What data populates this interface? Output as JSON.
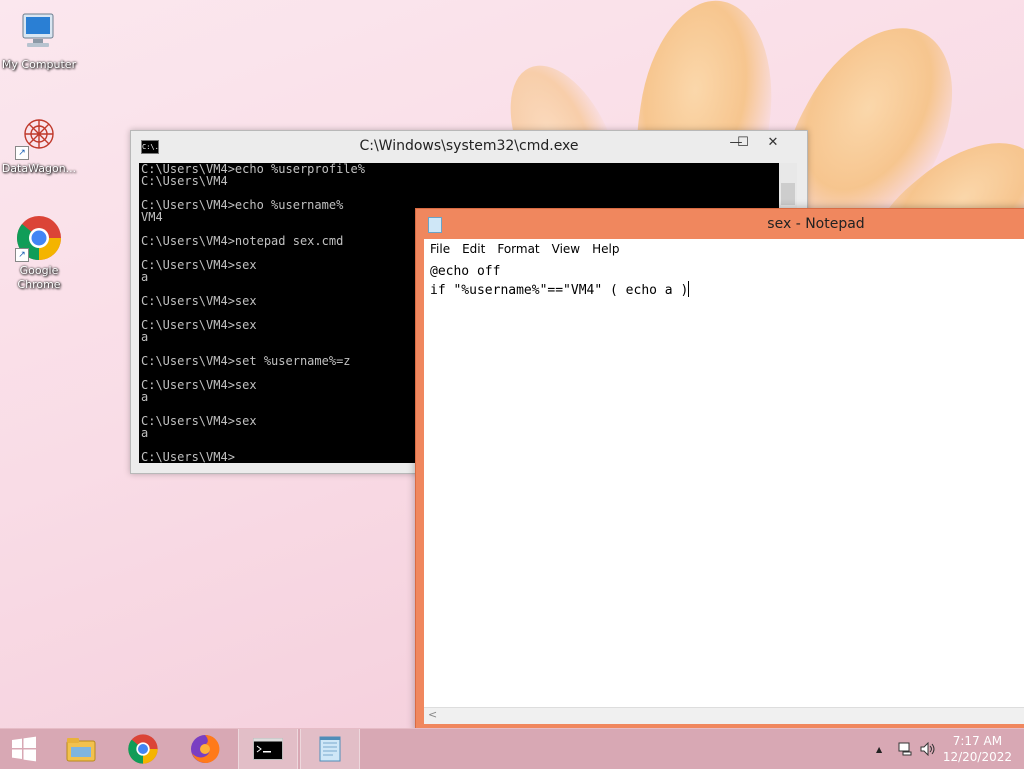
{
  "desktop": {
    "icons": [
      {
        "label": "My Computer",
        "icon": "computer-icon"
      },
      {
        "label": "DataWagon...",
        "icon": "datawagon-icon"
      },
      {
        "label": "Google Chrome",
        "icon": "chrome-icon"
      }
    ]
  },
  "cmd": {
    "title": "C:\\Windows\\system32\\cmd.exe",
    "icon_text": "C:\\.",
    "lines": [
      "C:\\Users\\VM4>echo %userprofile%",
      "C:\\Users\\VM4",
      "",
      "C:\\Users\\VM4>echo %username%",
      "VM4",
      "",
      "C:\\Users\\VM4>notepad sex.cmd",
      "",
      "C:\\Users\\VM4>sex",
      "a",
      "",
      "C:\\Users\\VM4>sex",
      "",
      "C:\\Users\\VM4>sex",
      "a",
      "",
      "C:\\Users\\VM4>set %username%=z",
      "",
      "C:\\Users\\VM4>sex",
      "a",
      "",
      "C:\\Users\\VM4>sex",
      "a",
      "",
      "C:\\Users\\VM4>"
    ],
    "buttons": {
      "minimize": "—",
      "maximize": "☐",
      "close": "✕"
    }
  },
  "notepad": {
    "title": "sex - Notepad",
    "menu": [
      "File",
      "Edit",
      "Format",
      "View",
      "Help"
    ],
    "line1": "@echo off",
    "line2": "if \"%username%\"==\"VM4\" ( echo a )",
    "hscroll_arrow": "<"
  },
  "taskbar": {
    "apps": [
      {
        "name": "start",
        "icon": "windows-start-icon"
      },
      {
        "name": "explorer",
        "icon": "file-explorer-icon"
      },
      {
        "name": "chrome",
        "icon": "chrome-icon"
      },
      {
        "name": "firefox",
        "icon": "firefox-icon"
      },
      {
        "name": "cmd",
        "icon": "cmd-icon"
      },
      {
        "name": "notepad",
        "icon": "notepad-icon"
      }
    ],
    "tray_arrow": "▲",
    "time": "7:17 AM",
    "date": "12/20/2022"
  },
  "colors": {
    "notepad_frame": "#f0875e",
    "taskbar": "#d8a8b4",
    "console_bg": "#000000",
    "console_fg": "#c0c0c0"
  }
}
